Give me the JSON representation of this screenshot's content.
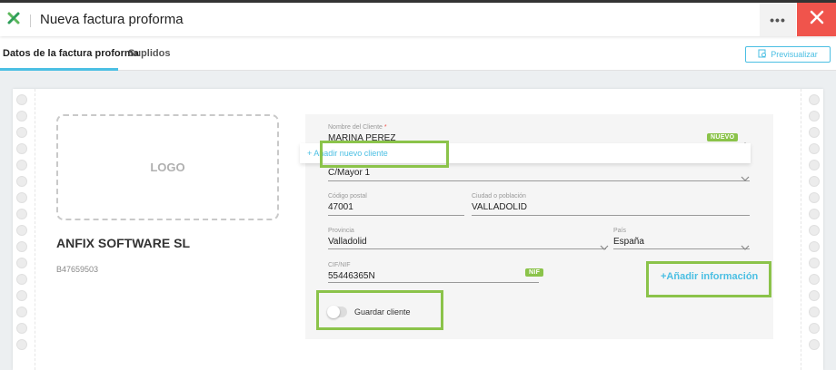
{
  "header": {
    "title": "Nueva factura proforma",
    "more_label": "•••",
    "logo_icon": "anfix-x-icon",
    "close_icon": "close-icon",
    "accent_color": "#4bbfe3",
    "close_color": "#f0544c"
  },
  "tabs": [
    {
      "label": "Datos de la factura proforma",
      "active": true
    },
    {
      "label": "Suplidos",
      "active": false
    }
  ],
  "preview": {
    "label": "Previsualizar",
    "icon": "document-preview-icon"
  },
  "company": {
    "logo_placeholder": "LOGO",
    "name": "ANFIX SOFTWARE SL",
    "cif": "B47659503"
  },
  "client": {
    "name_label": "Nombre del Cliente",
    "name_required": "*",
    "name_value": "MARINA PEREZ",
    "new_badge": "NUEVO",
    "add_client_link": "+ Añadir nuevo cliente",
    "address_value": "C/Mayor 1",
    "postal_label": "Código postal",
    "postal_value": "47001",
    "city_label": "Ciudad o población",
    "city_value": "VALLADOLID",
    "province_label": "Provincia",
    "province_value": "Valladolid",
    "country_label": "País",
    "country_value": "España",
    "nif_label": "CIF/NIF",
    "nif_value": "55446365N",
    "nif_badge": "NIF",
    "add_info_link": "+Añadir información",
    "save_client_label": "Guardar cliente",
    "save_client_on": false
  }
}
